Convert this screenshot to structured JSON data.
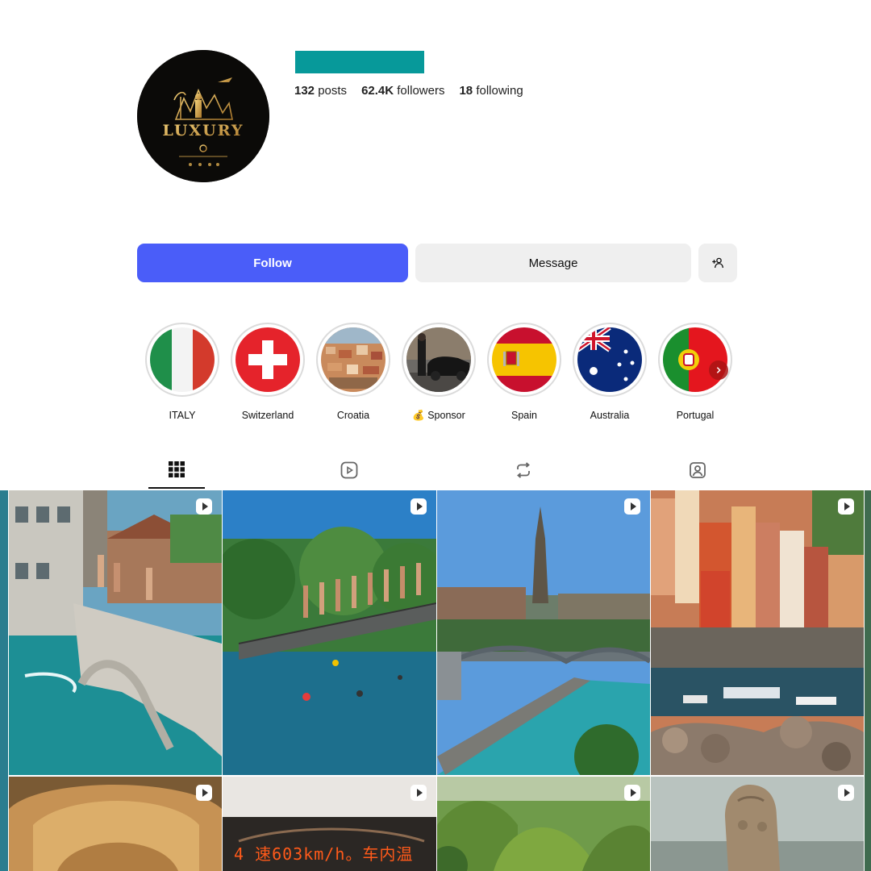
{
  "profile": {
    "avatar_text": "LUXURY",
    "stats": [
      {
        "value": "132",
        "label": "posts"
      },
      {
        "value": "62.4K",
        "label": "followers"
      },
      {
        "value": "18",
        "label": "following"
      }
    ]
  },
  "actions": {
    "follow_label": "Follow",
    "message_label": "Message",
    "add_icon": "add-person-icon"
  },
  "highlights": [
    {
      "label": "ITALY"
    },
    {
      "label": "Switzerland"
    },
    {
      "label": "Croatia"
    },
    {
      "label": "💰 Sponsor"
    },
    {
      "label": "Spain"
    },
    {
      "label": "Australia"
    },
    {
      "label": "Portugal"
    }
  ],
  "tabs": [
    {
      "icon": "grid-icon",
      "active": true
    },
    {
      "icon": "reels-icon",
      "active": false
    },
    {
      "icon": "reposts-icon",
      "active": false
    },
    {
      "icon": "tagged-icon",
      "active": false
    }
  ],
  "posts": [
    {
      "subject": "people jumping from bridge into river",
      "type": "reel"
    },
    {
      "subject": "swimmers under footbridge",
      "type": "reel"
    },
    {
      "subject": "Bern cathedral and bridge",
      "type": "reel"
    },
    {
      "subject": "Cinque Terre colorful village",
      "type": "reel"
    },
    {
      "subject": "stone tunnel",
      "type": "reel"
    },
    {
      "subject": "train speed display",
      "type": "reel",
      "overlay_text": "4  速603km/h。车内温"
    },
    {
      "subject": "Chocolate Hills",
      "type": "reel"
    },
    {
      "subject": "stone statue in fog",
      "type": "reel"
    }
  ],
  "colors": {
    "follow_button": "#4a5df9",
    "secondary_button": "#efefef",
    "username_block": "#07999a"
  }
}
